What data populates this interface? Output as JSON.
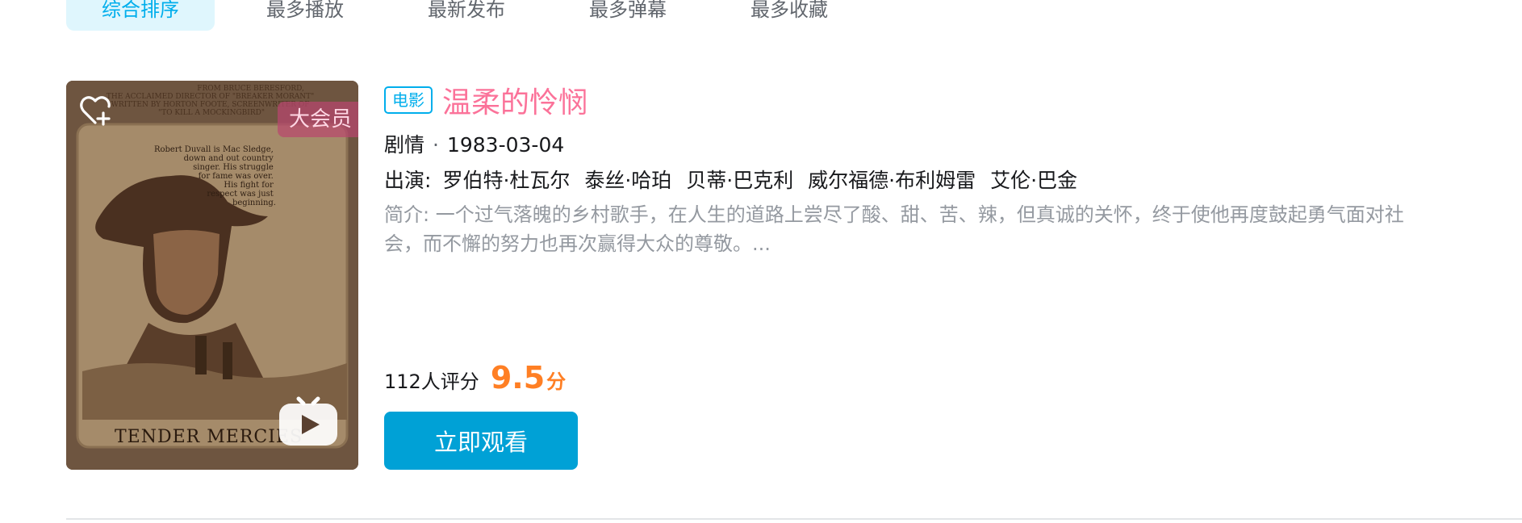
{
  "sort_tabs": [
    "综合排序",
    "最多播放",
    "最新发布",
    "最多弹幕",
    "最多收藏"
  ],
  "result": {
    "type_tag": "电影",
    "title": "温柔的怜悯",
    "genre": "剧情",
    "separator": "·",
    "release_date": "1983-03-04",
    "cast_label": "出演:",
    "cast": [
      "罗伯特·杜瓦尔",
      "泰丝·哈珀",
      "贝蒂·巴克利",
      "威尔福德·布利姆雷",
      "艾伦·巴金"
    ],
    "description": "简介: 一个过气落魄的乡村歌手，在人生的道路上尝尽了酸、甜、苦、辣，但真诚的关怀，终于使他再度鼓起勇气面对社会，而不懈的努力也再次赢得大众的尊敬。...",
    "rating_count": "112人评分",
    "score": "9.5",
    "score_unit": "分",
    "watch_button": "立即观看",
    "vip_badge": "大会员"
  },
  "poster": {
    "top_credits": [
      "FROM BRUCE BERESFORD,",
      "THE ACCLAIMED DIRECTOR OF \"BREAKER MORANT\"",
      "WRITTEN BY HORTON FOOTE, SCREENWRITER OF",
      "\"TO KILL A MOCKINGBIRD\""
    ],
    "tagline": [
      "Robert Duvall is Mac Sledge,",
      "down and out country",
      "singer. His struggle",
      "for fame was over.",
      "",
      "His fight for",
      "respect was just",
      "beginning."
    ],
    "film_title": "TENDER MERCIES"
  },
  "colors": {
    "accent": "#00aeec",
    "title_pink": "#fb7299",
    "score_orange": "#ff7f24",
    "button_blue": "#00a1d6"
  },
  "icons": {
    "favorite": "heart-plus-icon",
    "play": "tv-play-icon"
  }
}
